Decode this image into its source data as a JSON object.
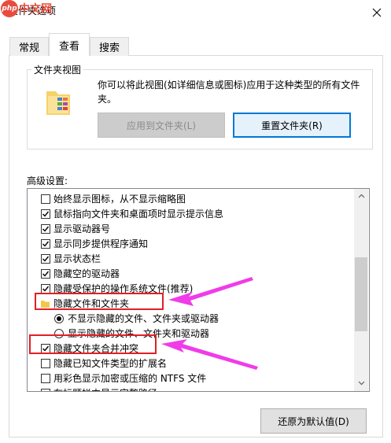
{
  "window": {
    "title": "文件夹选项",
    "watermark_logo": "php",
    "watermark_text": "中文网",
    "close_icon": "close-icon"
  },
  "tabs": [
    {
      "label": "常规",
      "selected": false
    },
    {
      "label": "查看",
      "selected": true
    },
    {
      "label": "搜索",
      "selected": false
    }
  ],
  "folder_views": {
    "legend": "文件夹视图",
    "description": "你可以将此视图(如详细信息或图标)应用于这种类型的所有文件夹。",
    "apply_button": "应用到文件夹(L)",
    "reset_button": "重置文件夹(R)"
  },
  "advanced": {
    "label": "高级设置:",
    "items": [
      {
        "text": "始终显示图标，从不显示缩略图",
        "type": "checkbox",
        "checked": false
      },
      {
        "text": "鼠标指向文件夹和桌面项时显示提示信息",
        "type": "checkbox",
        "checked": true
      },
      {
        "text": "显示驱动器号",
        "type": "checkbox",
        "checked": true
      },
      {
        "text": "显示同步提供程序通知",
        "type": "checkbox",
        "checked": true
      },
      {
        "text": "显示状态栏",
        "type": "checkbox",
        "checked": true
      },
      {
        "text": "隐藏空的驱动器",
        "type": "checkbox",
        "checked": true
      },
      {
        "text": "隐藏受保护的操作系统文件(推荐)",
        "type": "checkbox",
        "checked": true
      },
      {
        "text": "隐藏文件和文件夹",
        "type": "folder",
        "checked": null
      },
      {
        "text": "不显示隐藏的文件、文件夹或驱动器",
        "type": "radio",
        "checked": true
      },
      {
        "text": "显示隐藏的文件、文件夹和驱动器",
        "type": "radio",
        "checked": false
      },
      {
        "text": "隐藏文件夹合并冲突",
        "type": "checkbox",
        "checked": true
      },
      {
        "text": "隐藏已知文件类型的扩展名",
        "type": "checkbox",
        "checked": false
      },
      {
        "text": "用彩色显示加密或压缩的 NTFS 文件",
        "type": "checkbox",
        "checked": false
      },
      {
        "text": "在标题栏中显示完整路径",
        "type": "checkbox",
        "checked": false
      }
    ]
  },
  "restore_button": "还原为默认值(D)",
  "colors": {
    "highlight_box": "#e21f26",
    "arrow": "#f03ce8",
    "accent": "#0078d7"
  }
}
